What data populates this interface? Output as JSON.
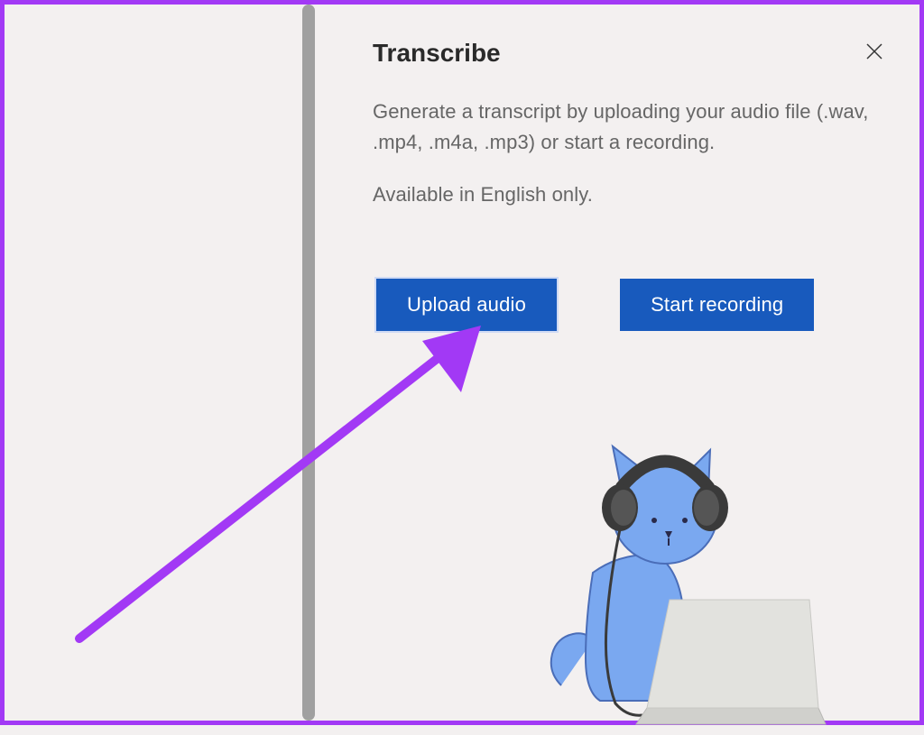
{
  "panel": {
    "title": "Transcribe",
    "description": "Generate a transcript by uploading your audio file (.wav, .mp4, .m4a, .mp3) or start a recording.",
    "availability": "Available in English only.",
    "buttons": {
      "upload": "Upload audio",
      "record": "Start recording"
    }
  }
}
